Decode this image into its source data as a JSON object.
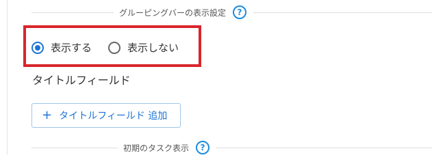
{
  "grouping_bar_section": {
    "title": "グルーピングバーの表示設定",
    "help_icon": "?",
    "options": [
      {
        "label": "表示する",
        "selected": true
      },
      {
        "label": "表示しない",
        "selected": false
      }
    ]
  },
  "title_field": {
    "heading": "タイトルフィールド",
    "add_button": {
      "icon": "+",
      "label": "タイトルフィールド 追加"
    }
  },
  "initial_task_section": {
    "title": "初期のタスク表示",
    "help_icon": "?"
  },
  "colors": {
    "accent": "#1b74d6",
    "highlight_border": "#d9252b"
  }
}
